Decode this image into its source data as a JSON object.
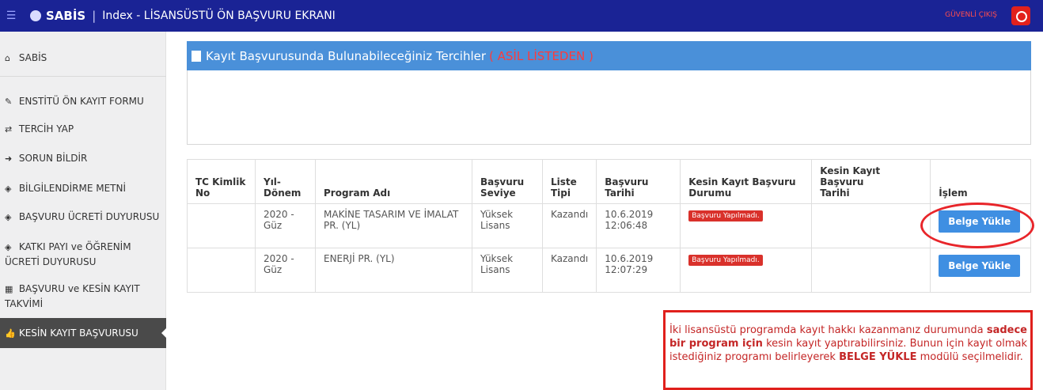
{
  "header": {
    "brand": "SABİS",
    "title": "Index - LİSANSÜSTÜ ÖN BAŞVURU EKRANI",
    "logout": "GÜVENLİ ÇIKIŞ"
  },
  "sidebar": {
    "items": [
      {
        "label": "SABİS",
        "icon": "home-icon"
      },
      {
        "label": "ENSTİTÜ ÖN KAYIT FORMU",
        "icon": "pencil-icon"
      },
      {
        "label": "TERCİH YAP",
        "icon": "exchange-icon"
      },
      {
        "label": "SORUN BİLDİR",
        "icon": "arrow-right-icon"
      },
      {
        "label": "BİLGİLENDİRME METNİ",
        "icon": "tag-icon"
      },
      {
        "label": "BAŞVURU ÜCRETİ DUYURUSU",
        "icon": "tag-icon"
      },
      {
        "label_line1": "KATKI PAYI ve ÖĞRENİM",
        "label_line2": "ÜCRETİ DUYURUSU",
        "icon": "tag-icon"
      },
      {
        "label_line1": "BAŞVURU ve KESİN KAYIT",
        "label_line2": "TAKVİMİ",
        "icon": "calendar-icon"
      },
      {
        "label": "KESİN KAYIT BAŞVURUSU",
        "icon": "thumbs-up-icon"
      }
    ]
  },
  "panel": {
    "title": "Kayıt Başvurusunda Bulunabileceğiniz Tercihler",
    "title_red": "( ASİL LİSTEDEN )"
  },
  "table": {
    "headers": {
      "tc": [
        "TC Kimlik",
        "No"
      ],
      "donem": [
        "Yıl-",
        "Dönem"
      ],
      "program": "Program Adı",
      "seviye": [
        "Başvuru",
        "Seviye"
      ],
      "liste": [
        "Liste",
        "Tipi"
      ],
      "tarih": "Başvuru Tarihi",
      "durum": [
        "Kesin Kayıt Başvuru",
        "Durumu"
      ],
      "kesin_tarih": [
        "Kesin Kayıt Başvuru",
        "Tarihi"
      ],
      "islem": "İşlem"
    },
    "rows": [
      {
        "tc": "",
        "donem": [
          "2020 -",
          "Güz"
        ],
        "program": [
          "MAKİNE TASARIM VE İMALAT",
          "PR. (YL)"
        ],
        "seviye": [
          "Yüksek",
          "Lisans"
        ],
        "liste": "Kazandı",
        "tarih": [
          "10.6.2019",
          "12:06:48"
        ],
        "durum": "Başvuru Yapılmadı.",
        "kesin_tarih": "",
        "button": "Belge Yükle"
      },
      {
        "tc": "",
        "donem": [
          "2020 -",
          "Güz"
        ],
        "program": [
          "ENERJİ PR. (YL)",
          ""
        ],
        "seviye": [
          "Yüksek",
          "Lisans"
        ],
        "liste": "Kazandı",
        "tarih": [
          "10.6.2019",
          "12:07:29"
        ],
        "durum": "Başvuru Yapılmadı.",
        "kesin_tarih": "",
        "button": "Belge Yükle"
      }
    ]
  },
  "note": {
    "p1": "İki lisansüstü programda kayıt hakkı kazanmanız durumunda",
    "b1": "sadece bir program için",
    "p2": " kesin kayıt yaptırabilirsiniz. Bunun için kayıt olmak istediğiniz programı belirleyerek ",
    "b2": "BELGE YÜKLE",
    "p3": " modülü seçilmelidir."
  },
  "colors": {
    "topbar": "#1a2395",
    "panel_header": "#4a90d9",
    "button": "#3f8fe2",
    "badge": "#d9312b",
    "highlight": "#e8252a"
  }
}
